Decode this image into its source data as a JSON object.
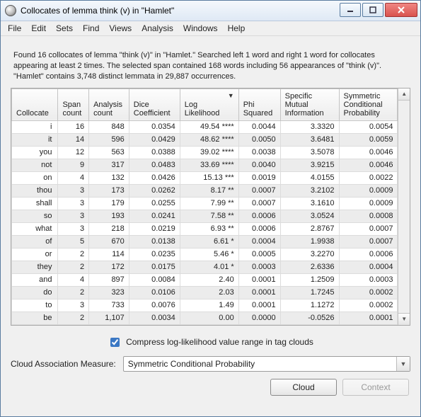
{
  "window": {
    "title": "Collocates of lemma think (v) in \"Hamlet\""
  },
  "menus": [
    "File",
    "Edit",
    "Sets",
    "Find",
    "Views",
    "Analysis",
    "Windows",
    "Help"
  ],
  "summary": "Found 16 collocates of lemma \"think (v)\" in \"Hamlet.\" Searched left 1 word and right 1 word for collocates appearing at least 2 times. The selected span contained 168 words including 56 appearances of \"think (v)\". \"Hamlet\" contains 3,748 distinct lemmata in 29,887 occurrences.",
  "columns": {
    "collocate": "Collocate",
    "span": "Span\ncount",
    "analysis": "Analysis\ncount",
    "dice": "Dice\nCoefficient",
    "log": "Log\nLikelihood",
    "phi": "Phi\nSquared",
    "smi": "Specific\nMutual\nInformation",
    "scp": "Symmetric\nConditional\nProbability"
  },
  "sort_column": "log",
  "sort_indicator": "▼",
  "rows": [
    {
      "collocate": "i",
      "span": "16",
      "analysis": "848",
      "dice": "0.0354",
      "log": "49.54 ****",
      "phi": "0.0044",
      "smi": "3.3320",
      "scp": "0.0054"
    },
    {
      "collocate": "it",
      "span": "14",
      "analysis": "596",
      "dice": "0.0429",
      "log": "48.62 ****",
      "phi": "0.0050",
      "smi": "3.6481",
      "scp": "0.0059"
    },
    {
      "collocate": "you",
      "span": "12",
      "analysis": "563",
      "dice": "0.0388",
      "log": "39.02 ****",
      "phi": "0.0038",
      "smi": "3.5078",
      "scp": "0.0046"
    },
    {
      "collocate": "not",
      "span": "9",
      "analysis": "317",
      "dice": "0.0483",
      "log": "33.69 ****",
      "phi": "0.0040",
      "smi": "3.9215",
      "scp": "0.0046"
    },
    {
      "collocate": "on",
      "span": "4",
      "analysis": "132",
      "dice": "0.0426",
      "log": "15.13 ***",
      "phi": "0.0019",
      "smi": "4.0155",
      "scp": "0.0022"
    },
    {
      "collocate": "thou",
      "span": "3",
      "analysis": "173",
      "dice": "0.0262",
      "log": "8.17 **",
      "phi": "0.0007",
      "smi": "3.2102",
      "scp": "0.0009"
    },
    {
      "collocate": "shall",
      "span": "3",
      "analysis": "179",
      "dice": "0.0255",
      "log": "7.99 **",
      "phi": "0.0007",
      "smi": "3.1610",
      "scp": "0.0009"
    },
    {
      "collocate": "so",
      "span": "3",
      "analysis": "193",
      "dice": "0.0241",
      "log": "7.58 **",
      "phi": "0.0006",
      "smi": "3.0524",
      "scp": "0.0008"
    },
    {
      "collocate": "what",
      "span": "3",
      "analysis": "218",
      "dice": "0.0219",
      "log": "6.93 **",
      "phi": "0.0006",
      "smi": "2.8767",
      "scp": "0.0007"
    },
    {
      "collocate": "of",
      "span": "5",
      "analysis": "670",
      "dice": "0.0138",
      "log": "6.61 *",
      "phi": "0.0004",
      "smi": "1.9938",
      "scp": "0.0007"
    },
    {
      "collocate": "or",
      "span": "2",
      "analysis": "114",
      "dice": "0.0235",
      "log": "5.46 *",
      "phi": "0.0005",
      "smi": "3.2270",
      "scp": "0.0006"
    },
    {
      "collocate": "they",
      "span": "2",
      "analysis": "172",
      "dice": "0.0175",
      "log": "4.01 *",
      "phi": "0.0003",
      "smi": "2.6336",
      "scp": "0.0004"
    },
    {
      "collocate": "and",
      "span": "4",
      "analysis": "897",
      "dice": "0.0084",
      "log": "2.40",
      "phi": "0.0001",
      "smi": "1.2509",
      "scp": "0.0003"
    },
    {
      "collocate": "do",
      "span": "2",
      "analysis": "323",
      "dice": "0.0106",
      "log": "2.03",
      "phi": "0.0001",
      "smi": "1.7245",
      "scp": "0.0002"
    },
    {
      "collocate": "to",
      "span": "3",
      "analysis": "733",
      "dice": "0.0076",
      "log": "1.49",
      "phi": "0.0001",
      "smi": "1.1272",
      "scp": "0.0002"
    },
    {
      "collocate": "be",
      "span": "2",
      "analysis": "1,107",
      "dice": "0.0034",
      "log": "0.00",
      "phi": "0.0000",
      "smi": "-0.0526",
      "scp": "0.0001"
    }
  ],
  "checkbox": {
    "label": "Compress log-likelihood value range in tag clouds",
    "checked": true
  },
  "assoc": {
    "label": "Cloud Association Measure:",
    "value": "Symmetric Conditional Probability"
  },
  "buttons": {
    "cloud": "Cloud",
    "context": "Context"
  },
  "chart_data": {
    "type": "table",
    "title": "Collocates of lemma think (v) in \"Hamlet\"",
    "columns": [
      "Collocate",
      "Span count",
      "Analysis count",
      "Dice Coefficient",
      "Log Likelihood",
      "Phi Squared",
      "Specific Mutual Information",
      "Symmetric Conditional Probability"
    ],
    "rows": [
      [
        "i",
        16,
        848,
        0.0354,
        49.54,
        0.0044,
        3.332,
        0.0054
      ],
      [
        "it",
        14,
        596,
        0.0429,
        48.62,
        0.005,
        3.6481,
        0.0059
      ],
      [
        "you",
        12,
        563,
        0.0388,
        39.02,
        0.0038,
        3.5078,
        0.0046
      ],
      [
        "not",
        9,
        317,
        0.0483,
        33.69,
        0.004,
        3.9215,
        0.0046
      ],
      [
        "on",
        4,
        132,
        0.0426,
        15.13,
        0.0019,
        4.0155,
        0.0022
      ],
      [
        "thou",
        3,
        173,
        0.0262,
        8.17,
        0.0007,
        3.2102,
        0.0009
      ],
      [
        "shall",
        3,
        179,
        0.0255,
        7.99,
        0.0007,
        3.161,
        0.0009
      ],
      [
        "so",
        3,
        193,
        0.0241,
        7.58,
        0.0006,
        3.0524,
        0.0008
      ],
      [
        "what",
        3,
        218,
        0.0219,
        6.93,
        0.0006,
        2.8767,
        0.0007
      ],
      [
        "of",
        5,
        670,
        0.0138,
        6.61,
        0.0004,
        1.9938,
        0.0007
      ],
      [
        "or",
        2,
        114,
        0.0235,
        5.46,
        0.0005,
        3.227,
        0.0006
      ],
      [
        "they",
        2,
        172,
        0.0175,
        4.01,
        0.0003,
        2.6336,
        0.0004
      ],
      [
        "and",
        4,
        897,
        0.0084,
        2.4,
        0.0001,
        1.2509,
        0.0003
      ],
      [
        "do",
        2,
        323,
        0.0106,
        2.03,
        0.0001,
        1.7245,
        0.0002
      ],
      [
        "to",
        3,
        733,
        0.0076,
        1.49,
        0.0001,
        1.1272,
        0.0002
      ],
      [
        "be",
        2,
        1107,
        0.0034,
        0.0,
        0.0,
        -0.0526,
        0.0001
      ]
    ]
  }
}
